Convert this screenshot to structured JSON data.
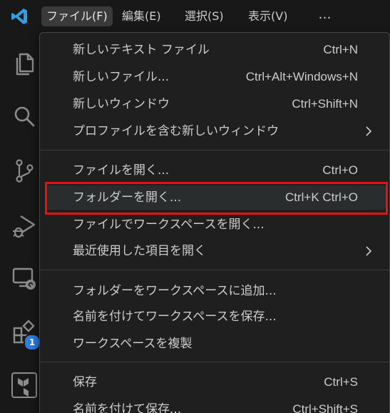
{
  "menubar": {
    "items": [
      {
        "label": "ファイル(F)",
        "active": true
      },
      {
        "label": "編集(E)",
        "active": false
      },
      {
        "label": "選択(S)",
        "active": false
      },
      {
        "label": "表示(V)",
        "active": false
      }
    ],
    "more_label": "…"
  },
  "activity_bar": {
    "icons": [
      "explorer-files-icon",
      "search-icon",
      "source-control-icon",
      "run-and-debug-icon",
      "remote-explorer-icon",
      "extensions-icon",
      "terraform-icon"
    ],
    "extensions_badge": "1",
    "badge_color": "#2f7de3"
  },
  "file_menu": {
    "groups": [
      [
        {
          "label": "新しいテキスト ファイル",
          "accel": "Ctrl+N"
        },
        {
          "label": "新しいファイル...",
          "accel": "Ctrl+Alt+Windows+N"
        },
        {
          "label": "新しいウィンドウ",
          "accel": "Ctrl+Shift+N"
        },
        {
          "label": "プロファイルを含む新しいウィンドウ",
          "accel": "",
          "submenu": true
        }
      ],
      [
        {
          "label": "ファイルを開く...",
          "accel": "Ctrl+O"
        },
        {
          "label": "フォルダーを開く...",
          "accel": "Ctrl+K Ctrl+O",
          "highlighted": true
        },
        {
          "label": "ファイルでワークスペースを開く...",
          "accel": ""
        },
        {
          "label": "最近使用した項目を開く",
          "accel": "",
          "submenu": true
        }
      ],
      [
        {
          "label": "フォルダーをワークスペースに追加...",
          "accel": ""
        },
        {
          "label": "名前を付けてワークスペースを保存...",
          "accel": ""
        },
        {
          "label": "ワークスペースを複製",
          "accel": ""
        }
      ],
      [
        {
          "label": "保存",
          "accel": "Ctrl+S"
        },
        {
          "label": "名前を付けて保存...",
          "accel": "Ctrl+Shift+S"
        }
      ]
    ]
  },
  "colors": {
    "accent_blue": "#2f9fe6",
    "highlight_red": "#e81010",
    "menu_background": "#1f1f1f",
    "text": "#cccccc"
  }
}
